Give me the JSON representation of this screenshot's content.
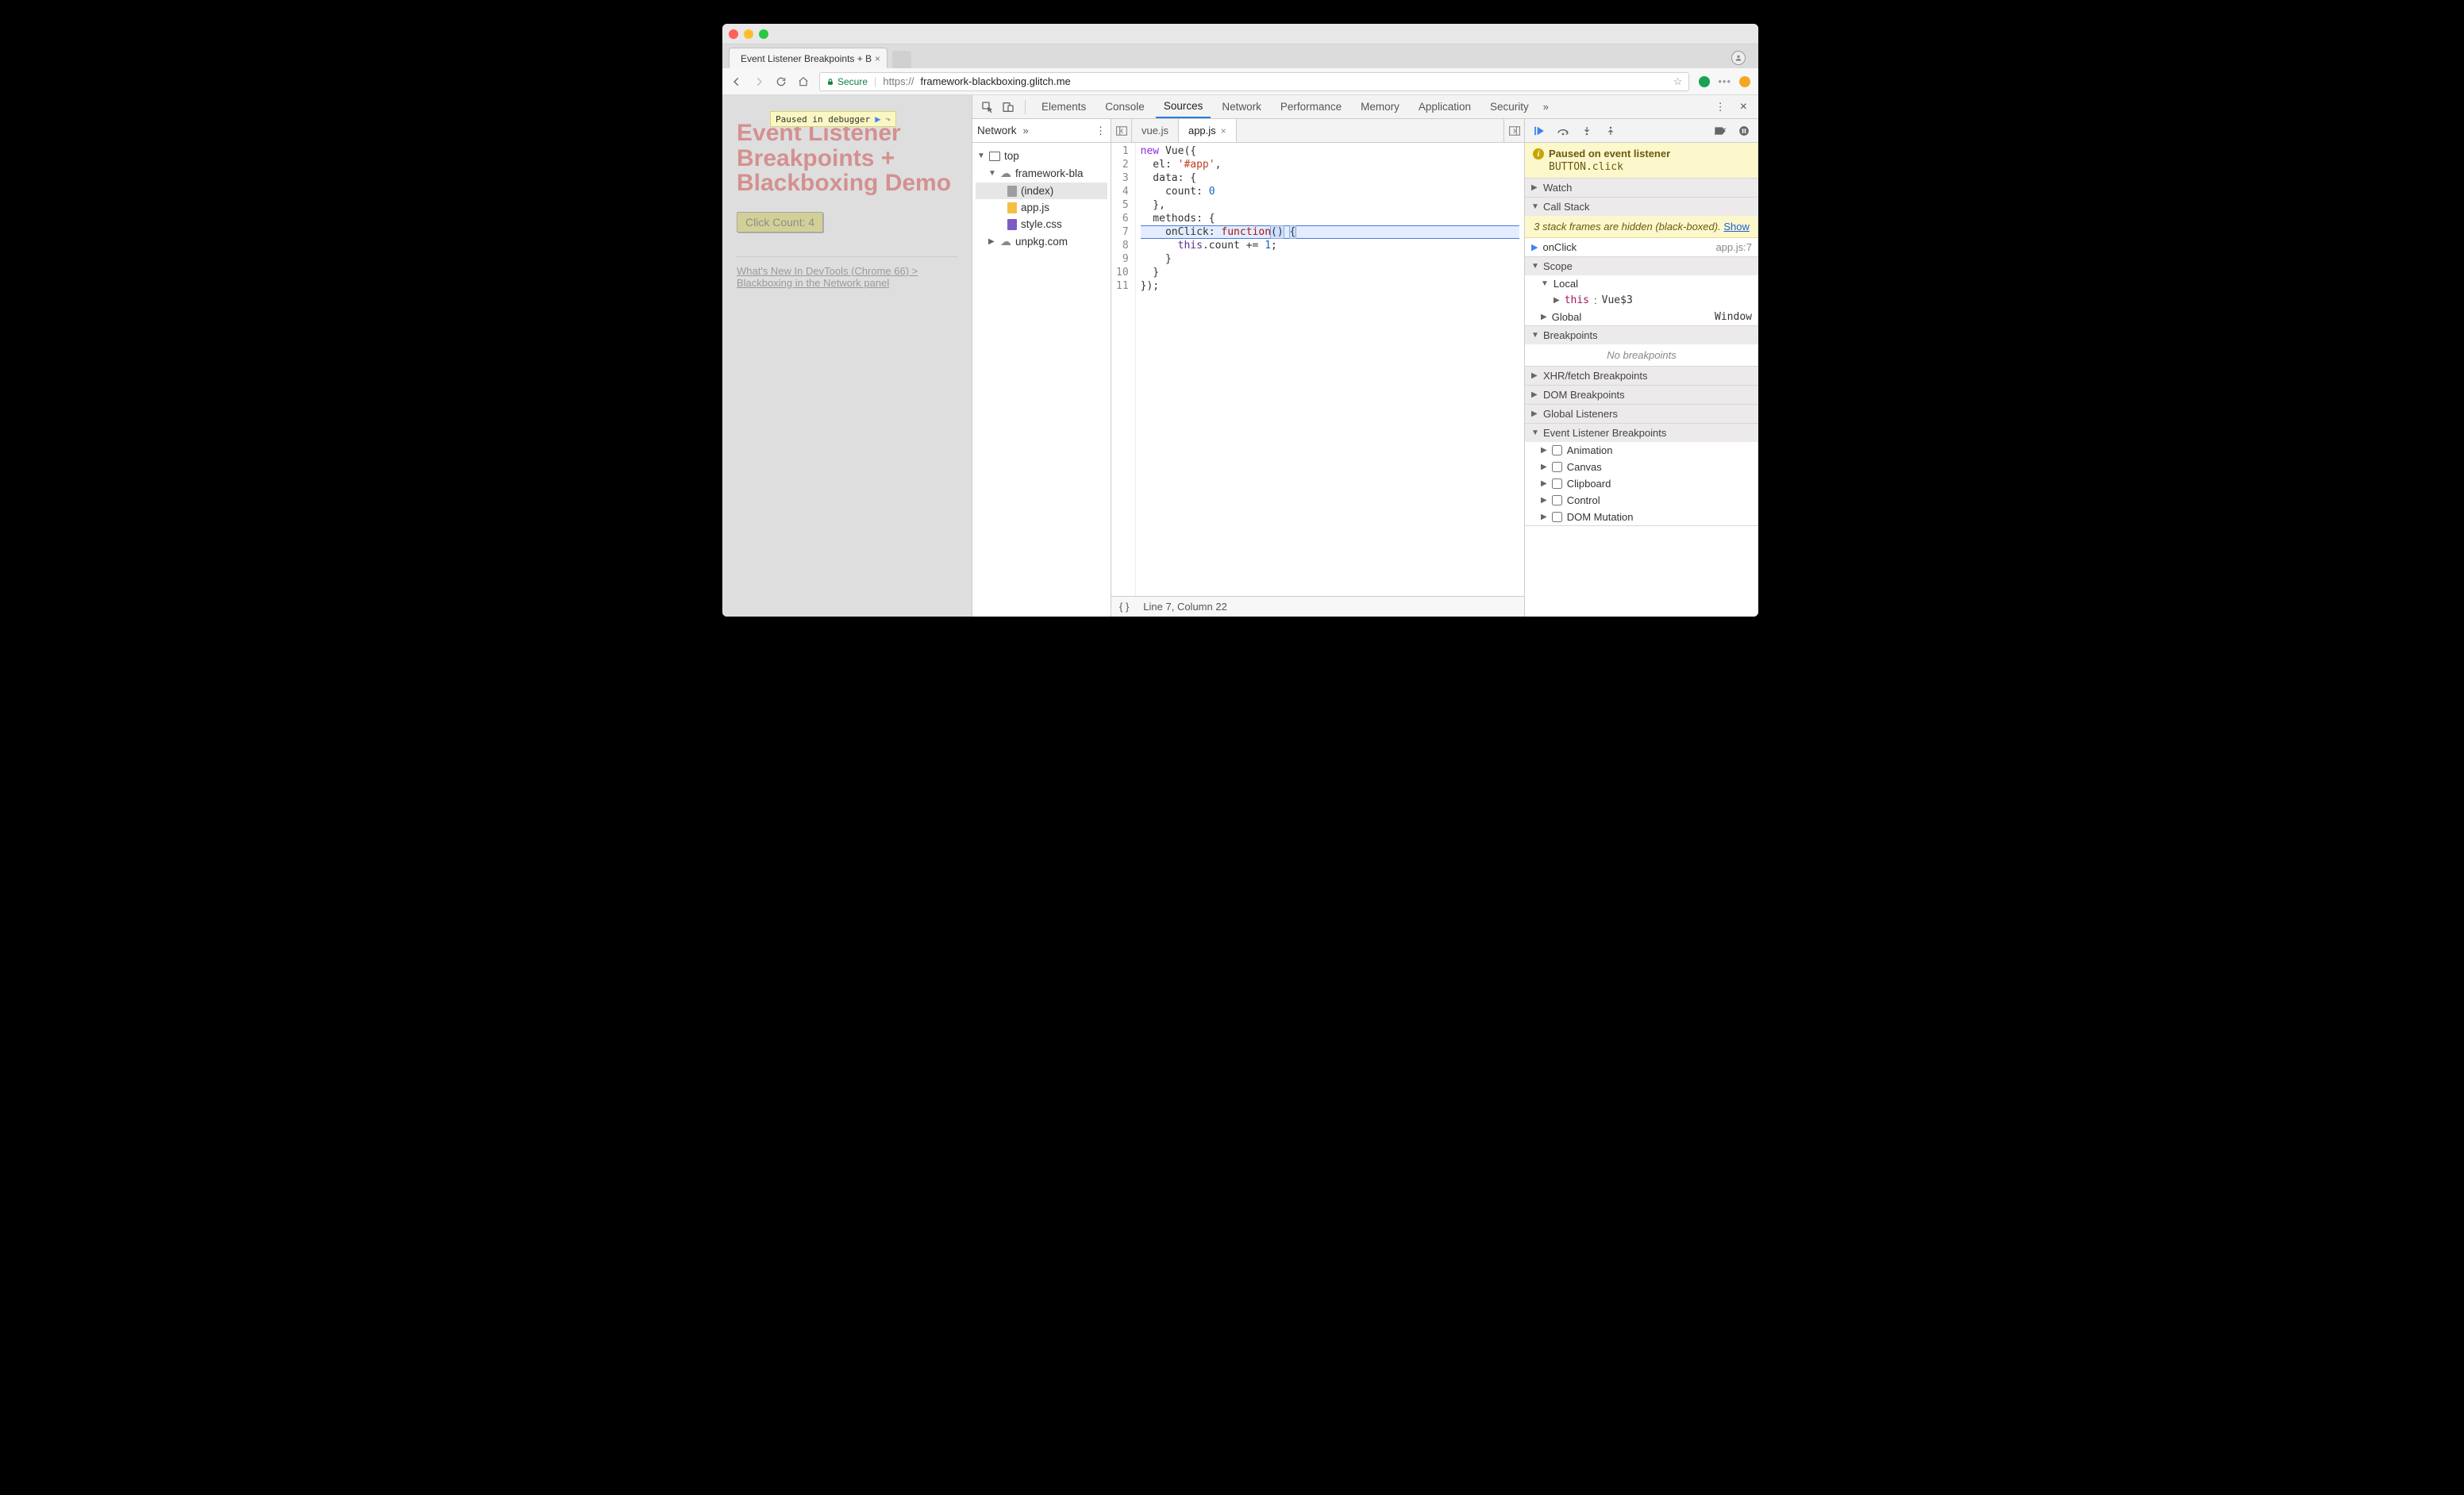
{
  "browser": {
    "tab_title": "Event Listener Breakpoints + B",
    "secure_label": "Secure",
    "url_scheme": "https://",
    "url_host": "framework-blackboxing.glitch.me"
  },
  "page": {
    "pause_badge": "Paused in debugger",
    "heading": "Event Listener Breakpoints + Blackboxing Demo",
    "button": "Click Count: 4",
    "footer_link": "What's New In DevTools (Chrome 66) > Blackboxing in the Network panel"
  },
  "devtools": {
    "tabs": [
      "Elements",
      "Console",
      "Sources",
      "Network",
      "Performance",
      "Memory",
      "Application",
      "Security"
    ],
    "active_tab": "Sources",
    "nav": {
      "pane": "Network",
      "tree": {
        "top": "top",
        "domain": "framework-bla",
        "files": [
          {
            "name": "(index)",
            "icon": "file"
          },
          {
            "name": "app.js",
            "icon": "js"
          },
          {
            "name": "style.css",
            "icon": "css"
          }
        ],
        "domain2": "unpkg.com"
      }
    },
    "editor": {
      "tabs": [
        {
          "name": "vue.js",
          "active": false
        },
        {
          "name": "app.js",
          "active": true
        }
      ],
      "lines": [
        "new Vue({",
        "  el: '#app',",
        "  data: {",
        "    count: 0",
        "  },",
        "  methods: {",
        "    onClick: function() {",
        "      this.count += 1;",
        "    }",
        "  }",
        "});"
      ],
      "status": "Line 7, Column 22"
    },
    "debugger": {
      "paused": {
        "title": "Paused on event listener",
        "detail": "BUTTON.click"
      },
      "sections": {
        "watch": "Watch",
        "call_stack": "Call Stack",
        "blackbox_msg_a": "3 stack frames are hidden (black-boxed). ",
        "blackbox_show": "Show",
        "stack_fn": "onClick",
        "stack_loc": "app.js:7",
        "scope": "Scope",
        "scope_local": "Local",
        "scope_this_k": "this",
        "scope_this_v": "Vue$3",
        "scope_global": "Global",
        "scope_global_v": "Window",
        "breakpoints": "Breakpoints",
        "breakpoints_empty": "No breakpoints",
        "xhr": "XHR/fetch Breakpoints",
        "dom": "DOM Breakpoints",
        "global_listeners": "Global Listeners",
        "event_listener_bp": "Event Listener Breakpoints",
        "categories": [
          "Animation",
          "Canvas",
          "Clipboard",
          "Control",
          "DOM Mutation"
        ]
      }
    }
  }
}
